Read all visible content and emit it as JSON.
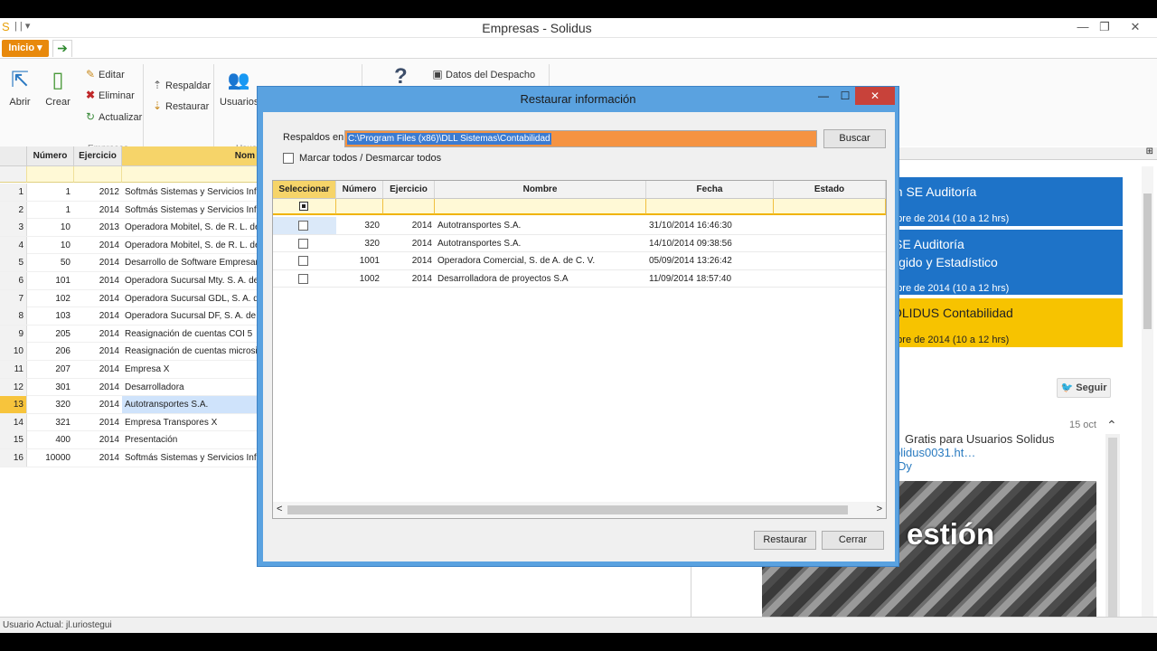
{
  "window": {
    "title": "Empresas - Solidus",
    "controls": {
      "minimize": "—",
      "restore": "❐",
      "close": "✕"
    }
  },
  "tabs": {
    "inicio": "Inicio ▾",
    "arrow": "➔"
  },
  "ribbon": {
    "abrir": "Abrir",
    "crear": "Crear",
    "editar": "Editar",
    "eliminar": "Eliminar",
    "actualizar": "Actualizar",
    "respaldar": "Respaldar",
    "restaurar": "Restaurar",
    "usuarios": "Usuarios",
    "help": "?",
    "datos_despacho": "Datos del Despacho",
    "group_empresas": "Empresas",
    "group_usuarios": "Usua"
  },
  "main_grid": {
    "headers": {
      "numero": "Número",
      "ejercicio": "Ejercicio",
      "nombre": "Nom"
    },
    "rows": [
      {
        "n": "1",
        "numero": "1",
        "ejercicio": "2012",
        "nombre": "Softmás Sistemas y Servicios Info"
      },
      {
        "n": "2",
        "numero": "1",
        "ejercicio": "2014",
        "nombre": "Softmás Sistemas y Servicios Info"
      },
      {
        "n": "3",
        "numero": "10",
        "ejercicio": "2013",
        "nombre": "Operadora Mobitel, S. de R. L. de"
      },
      {
        "n": "4",
        "numero": "10",
        "ejercicio": "2014",
        "nombre": "Operadora Mobitel, S. de R. L. de"
      },
      {
        "n": "5",
        "numero": "50",
        "ejercicio": "2014",
        "nombre": "Desarrollo de Software Empresari"
      },
      {
        "n": "6",
        "numero": "101",
        "ejercicio": "2014",
        "nombre": "Operadora Sucursal Mty. S. A. de"
      },
      {
        "n": "7",
        "numero": "102",
        "ejercicio": "2014",
        "nombre": "Operadora Sucursal GDL, S. A. de"
      },
      {
        "n": "8",
        "numero": "103",
        "ejercicio": "2014",
        "nombre": "Operadora Sucursal DF, S. A. de"
      },
      {
        "n": "9",
        "numero": "205",
        "ejercicio": "2014",
        "nombre": "Reasignación de cuentas COI 5"
      },
      {
        "n": "10",
        "numero": "206",
        "ejercicio": "2014",
        "nombre": "Reasignación de cuentas microsi"
      },
      {
        "n": "11",
        "numero": "207",
        "ejercicio": "2014",
        "nombre": "Empresa X"
      },
      {
        "n": "12",
        "numero": "301",
        "ejercicio": "2014",
        "nombre": "Desarrolladora"
      },
      {
        "n": "13",
        "numero": "320",
        "ejercicio": "2014",
        "nombre": "Autotransportes S.A."
      },
      {
        "n": "14",
        "numero": "321",
        "ejercicio": "2014",
        "nombre": "Empresa Transpores X"
      },
      {
        "n": "15",
        "numero": "400",
        "ejercicio": "2014",
        "nombre": "Presentación"
      },
      {
        "n": "16",
        "numero": "10000",
        "ejercicio": "2014",
        "nombre": "Softmás Sistemas y Servicios Info"
      }
    ]
  },
  "dialog": {
    "title": "Restaurar información",
    "controls": {
      "minimize": "—",
      "maximize": "☐",
      "close": "✕"
    },
    "respaldos_label": "Respaldos en",
    "path": "C:\\Program Files (x86)\\DLL Sistemas\\Contabilidad",
    "buscar": "Buscar",
    "marcar_todos": "Marcar todos / Desmarcar todos",
    "headers": {
      "seleccionar": "Seleccionar",
      "numero": "Número",
      "ejercicio": "Ejercicio",
      "nombre": "Nombre",
      "fecha": "Fecha",
      "estado": "Estado"
    },
    "rows": [
      {
        "numero": "320",
        "ejercicio": "2014",
        "nombre": "Autotransportes S.A.",
        "fecha": "31/10/2014 16:46:30",
        "checked": false
      },
      {
        "numero": "320",
        "ejercicio": "2014",
        "nombre": "Autotransportes S.A.",
        "fecha": "14/10/2014 09:38:56",
        "checked": false
      },
      {
        "numero": "1001",
        "ejercicio": "2014",
        "nombre": "Operadora Comercial, S. de A. de C. V.",
        "fecha": "05/09/2014 13:26:42",
        "checked": false
      },
      {
        "numero": "1002",
        "ejercicio": "2014",
        "nombre": "Desarrolladora de proyectos S.A",
        "fecha": "11/09/2014 18:57:40",
        "checked": false
      }
    ],
    "restaurar": "Restaurar",
    "cerrar": "Cerrar",
    "scroll_left": "<",
    "scroll_right": ">"
  },
  "news": {
    "card1": {
      "l1": "ón SE Auditoría",
      "l3": "mbre de 2014 (10 a 12 hrs)"
    },
    "card2": {
      "l1": "SE Auditoría",
      "l2": "igido y Estadístico",
      "l3": "mbre de 2014 (10 a 12 hrs)"
    },
    "card3": {
      "l1": "OLIDUS Contabilidad",
      "l3": "mbre de 2014 (10 a 12 hrs)"
    },
    "seguir": "Seguir",
    "tweet_date": "15 oct",
    "tweet_l1": "Gratis para Usuarios Solidus",
    "tweet_l2": "olidus0031.ht…",
    "tweet_l3": "Dy",
    "image_text": "estión",
    "colors": {
      "blue": "#1e73c8",
      "yellow": "#f7c300"
    }
  },
  "status": {
    "usuario": "Usuario Actual: jl.uriostegui"
  }
}
